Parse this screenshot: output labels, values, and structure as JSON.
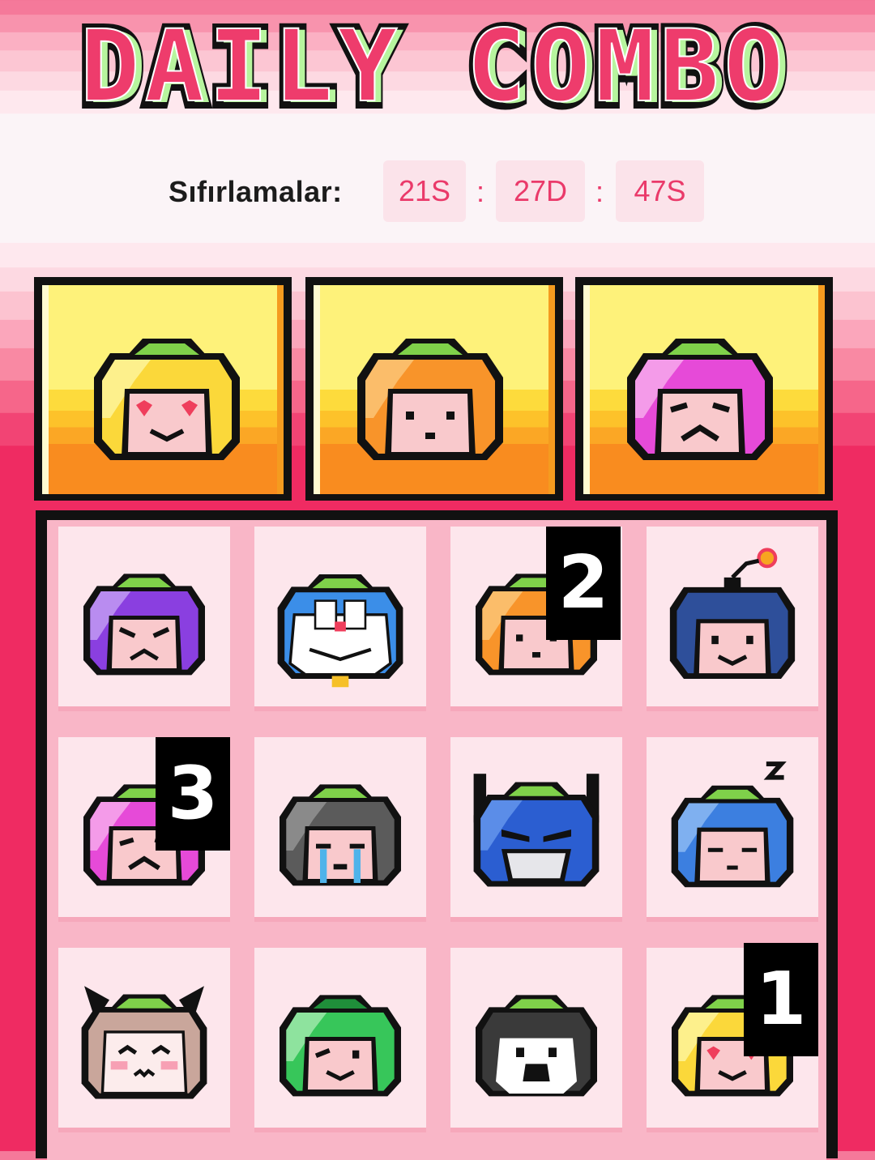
{
  "title": "DAILY COMBO",
  "reset": {
    "label": "Sıfırlamalar:",
    "hours": "21S",
    "minutes": "27D",
    "seconds": "47S",
    "separator": ":"
  },
  "combo_slots": [
    {
      "icon": "tomato-yellow-heart-eyes-icon"
    },
    {
      "icon": "tomato-orange-neutral-icon"
    },
    {
      "icon": "tomato-magenta-sad-icon"
    }
  ],
  "grid": [
    {
      "icon": "tomato-purple-angry-icon",
      "badge": ""
    },
    {
      "icon": "doraemon-icon",
      "badge": ""
    },
    {
      "icon": "tomato-orange-neutral-icon",
      "badge": "2"
    },
    {
      "icon": "bomb-character-icon",
      "badge": ""
    },
    {
      "icon": "tomato-magenta-sad-icon",
      "badge": "3"
    },
    {
      "icon": "tomato-gray-crying-icon",
      "badge": ""
    },
    {
      "icon": "robot-helmet-icon",
      "badge": ""
    },
    {
      "icon": "tomato-blue-sleeping-icon",
      "badge": ""
    },
    {
      "icon": "cat-ears-character-icon",
      "badge": ""
    },
    {
      "icon": "tomato-green-wink-icon",
      "badge": ""
    },
    {
      "icon": "tomato-black-open-mouth-icon",
      "badge": ""
    },
    {
      "icon": "tomato-yellow-heart-eyes-icon",
      "badge": "1"
    }
  ],
  "colors": {
    "accent": "#ea3a6a",
    "background_bottom": "#ef2b62",
    "combo_slot_top": "#fef27a",
    "combo_slot_bottom": "#f98c1f",
    "cell_background": "#fde6ec"
  }
}
